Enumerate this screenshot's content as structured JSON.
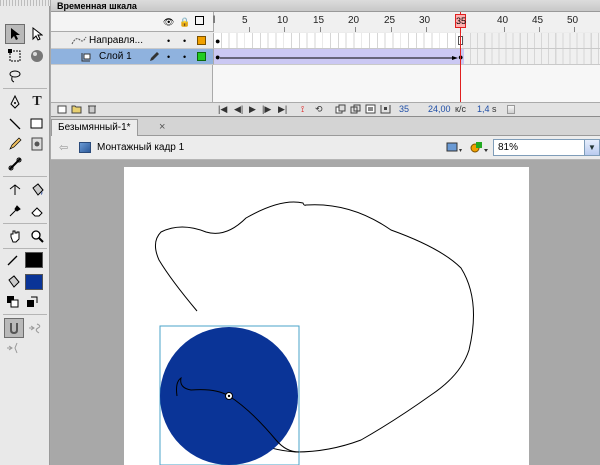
{
  "timeline": {
    "title": "Временная шкала",
    "ruler_ticks": [
      "5",
      "10",
      "15",
      "20",
      "25",
      "30",
      "35",
      "40",
      "45",
      "50"
    ],
    "current_frame": "35",
    "layers": [
      {
        "name": "Направля..."
      },
      {
        "name": "Слой 1"
      }
    ],
    "footer": {
      "frame": "35",
      "fps": "24,00",
      "fps_unit": "к/с",
      "time": "1,4",
      "time_unit": "s"
    }
  },
  "document": {
    "tab_title": "Безымянный-1*",
    "tab_close": "×",
    "scene_label": "Монтажный кадр 1",
    "zoom": "81%"
  },
  "tools": {
    "text_tool_label": "T",
    "stroke_color": "#000000",
    "fill_color": "#0a3497"
  },
  "colors": {
    "circle_fill": "#0a3497",
    "selection_box": "#4aa3c8",
    "playhead": "#e02020",
    "active_layer_bg": "#8fb2de",
    "guide_color": "#f0a000",
    "layer1_color": "#22cc22"
  }
}
